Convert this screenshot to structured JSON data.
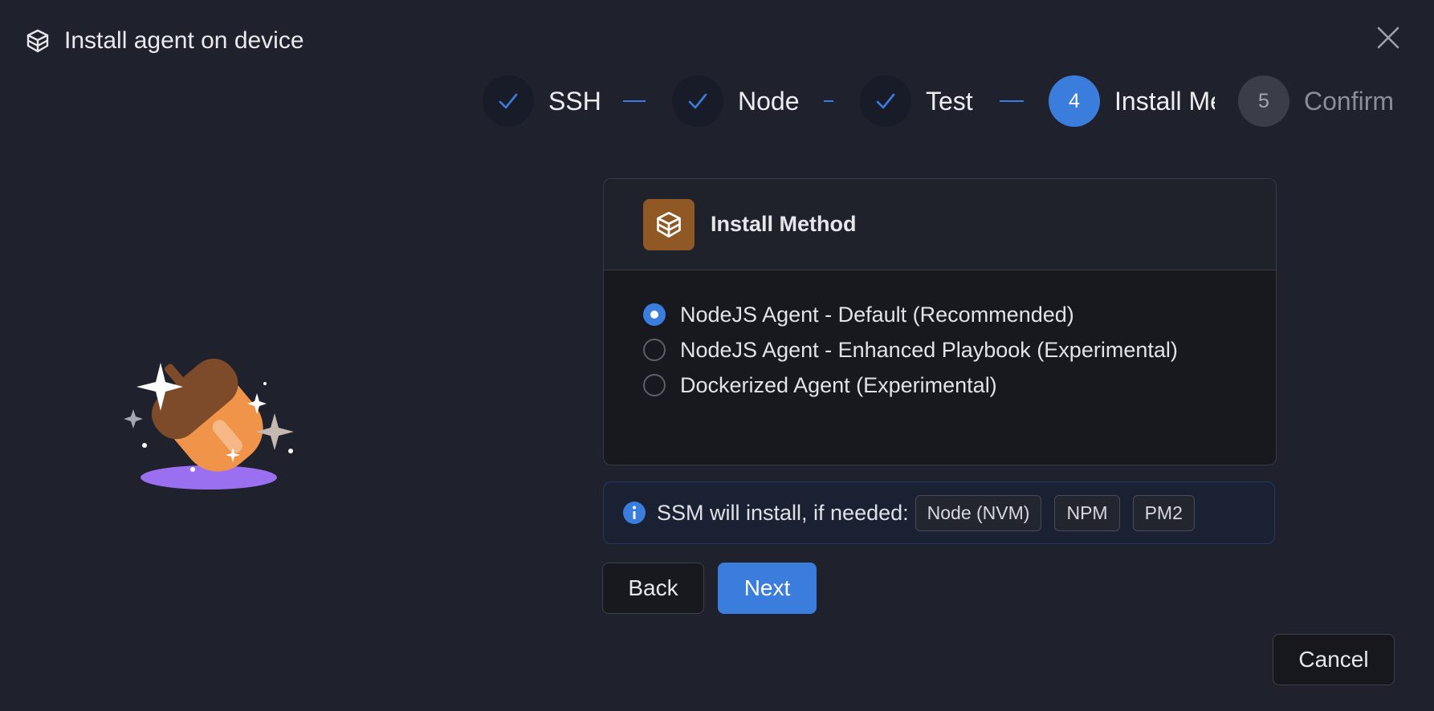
{
  "dialog": {
    "title": "Install agent on device",
    "title_icon": "package-icon",
    "close_icon": "close-icon"
  },
  "stepper": {
    "steps": [
      {
        "label": "SSH",
        "state": "done",
        "marker": "check-icon"
      },
      {
        "label": "Node",
        "state": "done",
        "marker": "check-icon"
      },
      {
        "label": "Test",
        "state": "done",
        "marker": "check-icon"
      },
      {
        "label": "Install Method",
        "number": "4",
        "state": "active"
      },
      {
        "label": "Confirm",
        "number": "5",
        "state": "pending"
      }
    ]
  },
  "install_method": {
    "title": "Install Method",
    "icon": "package-icon",
    "options": [
      {
        "label": "NodeJS Agent - Default (Recommended)",
        "selected": true
      },
      {
        "label": "NodeJS Agent - Enhanced Playbook (Experimental)",
        "selected": false
      },
      {
        "label": "Dockerized Agent (Experimental)",
        "selected": false
      }
    ]
  },
  "info_banner": {
    "icon": "info-icon",
    "text": "SSM will install, if needed:",
    "chips": [
      "Node (NVM)",
      "NPM",
      "PM2"
    ]
  },
  "buttons": {
    "back": "Back",
    "next": "Next",
    "cancel": "Cancel"
  },
  "illustration": "acorn-sparkle-illustration",
  "colors": {
    "background": "#1f222c",
    "accent": "#3b7ddd",
    "method_icon_bg": "#8f5824"
  }
}
